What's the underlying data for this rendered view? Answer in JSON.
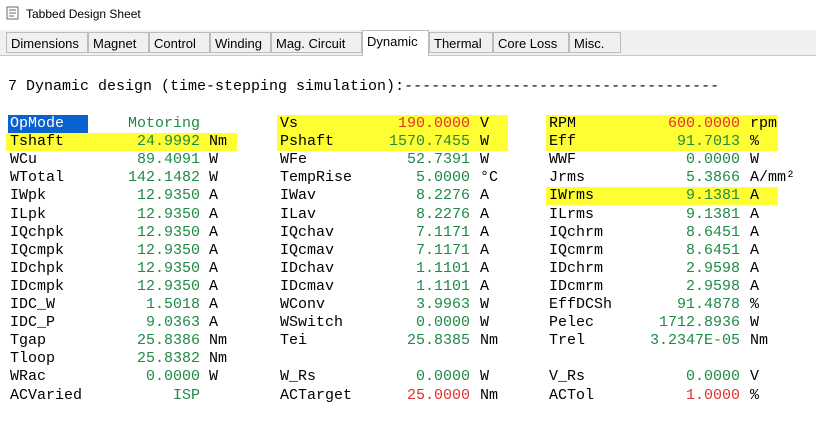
{
  "window": {
    "title": "Tabbed Design Sheet",
    "icon": "sheet-icon"
  },
  "tabs": [
    {
      "label": "Dimensions",
      "active": false
    },
    {
      "label": "Magnet",
      "active": false
    },
    {
      "label": "Control",
      "active": false
    },
    {
      "label": "Winding",
      "active": false
    },
    {
      "label": "Mag. Circuit",
      "active": false
    },
    {
      "label": "Dynamic",
      "active": true
    },
    {
      "label": "Thermal",
      "active": false
    },
    {
      "label": "Core Loss",
      "active": false
    },
    {
      "label": "Misc.",
      "active": false
    }
  ],
  "heading": "7 Dynamic design (time-stepping simulation):-----------------------------------",
  "colors": {
    "label": "#000000",
    "value_green": "#1f8a46",
    "value_red": "#e0322f",
    "highlight": "#fffe33",
    "selection": "#0a62d0"
  },
  "rows": [
    [
      {
        "label": "OpMode",
        "value": "Motoring",
        "unit": ""
      },
      {
        "label": "Vs",
        "value": "190.0000",
        "unit": "V"
      },
      {
        "label": "RPM",
        "value": "600.0000",
        "unit": "rpm"
      }
    ],
    [
      {
        "label": "Tshaft",
        "value": "24.9992",
        "unit": "Nm"
      },
      {
        "label": "Pshaft",
        "value": "1570.7455",
        "unit": "W"
      },
      {
        "label": "Eff",
        "value": "91.7013",
        "unit": "%"
      }
    ],
    [
      {
        "label": "WCu",
        "value": "89.4091",
        "unit": "W"
      },
      {
        "label": "WFe",
        "value": "52.7391",
        "unit": "W"
      },
      {
        "label": "WWF",
        "value": "0.0000",
        "unit": "W"
      }
    ],
    [
      {
        "label": "WTotal",
        "value": "142.1482",
        "unit": "W"
      },
      {
        "label": "TempRise",
        "value": "5.0000",
        "unit": "°C"
      },
      {
        "label": "Jrms",
        "value": "5.3866",
        "unit": "A/mm²"
      }
    ],
    [
      {
        "label": "IWpk",
        "value": "12.9350",
        "unit": "A"
      },
      {
        "label": "IWav",
        "value": "8.2276",
        "unit": "A"
      },
      {
        "label": "IWrms",
        "value": "9.1381",
        "unit": "A"
      }
    ],
    [
      {
        "label": "ILpk",
        "value": "12.9350",
        "unit": "A"
      },
      {
        "label": "ILav",
        "value": "8.2276",
        "unit": "A"
      },
      {
        "label": "ILrms",
        "value": "9.1381",
        "unit": "A"
      }
    ],
    [
      {
        "label": "IQchpk",
        "value": "12.9350",
        "unit": "A"
      },
      {
        "label": "IQchav",
        "value": "7.1171",
        "unit": "A"
      },
      {
        "label": "IQchrm",
        "value": "8.6451",
        "unit": "A"
      }
    ],
    [
      {
        "label": "IQcmpk",
        "value": "12.9350",
        "unit": "A"
      },
      {
        "label": "IQcmav",
        "value": "7.1171",
        "unit": "A"
      },
      {
        "label": "IQcmrm",
        "value": "8.6451",
        "unit": "A"
      }
    ],
    [
      {
        "label": "IDchpk",
        "value": "12.9350",
        "unit": "A"
      },
      {
        "label": "IDchav",
        "value": "1.1101",
        "unit": "A"
      },
      {
        "label": "IDchrm",
        "value": "2.9598",
        "unit": "A"
      }
    ],
    [
      {
        "label": "IDcmpk",
        "value": "12.9350",
        "unit": "A"
      },
      {
        "label": "IDcmav",
        "value": "1.1101",
        "unit": "A"
      },
      {
        "label": "IDcmrm",
        "value": "2.9598",
        "unit": "A"
      }
    ],
    [
      {
        "label": "IDC_W",
        "value": "1.5018",
        "unit": "A"
      },
      {
        "label": "WConv",
        "value": "3.9963",
        "unit": "W"
      },
      {
        "label": "EffDCSh",
        "value": "91.4878",
        "unit": "%"
      }
    ],
    [
      {
        "label": "IDC_P",
        "value": "9.0363",
        "unit": "A"
      },
      {
        "label": "WSwitch",
        "value": "0.0000",
        "unit": "W"
      },
      {
        "label": "Pelec",
        "value": "1712.8936",
        "unit": "W"
      }
    ],
    [
      {
        "label": "Tgap",
        "value": "25.8386",
        "unit": "Nm"
      },
      {
        "label": "Tei",
        "value": "25.8385",
        "unit": "Nm"
      },
      {
        "label": "Trel",
        "value": "3.2347E-05",
        "unit": "Nm"
      }
    ],
    [
      {
        "label": "Tloop",
        "value": "25.8382",
        "unit": "Nm"
      },
      null,
      null
    ],
    [
      {
        "label": "WRac",
        "value": "0.0000",
        "unit": "W"
      },
      {
        "label": "W_Rs",
        "value": "0.0000",
        "unit": "W"
      },
      {
        "label": "V_Rs",
        "value": "0.0000",
        "unit": "V"
      }
    ],
    [
      {
        "label": "ACVaried",
        "value": "ISP",
        "unit": ""
      },
      {
        "label": "ACTarget",
        "value": "25.0000",
        "unit": "Nm"
      },
      {
        "label": "ACTol",
        "value": "1.0000",
        "unit": "%"
      }
    ]
  ],
  "red_values": [
    "0,1",
    "0,2",
    "15,1",
    "15,2"
  ],
  "highlighted": [
    "1,0",
    "0,1",
    "1,1",
    "0,2",
    "1,2",
    "4,2"
  ],
  "selected": [
    "0,0"
  ]
}
